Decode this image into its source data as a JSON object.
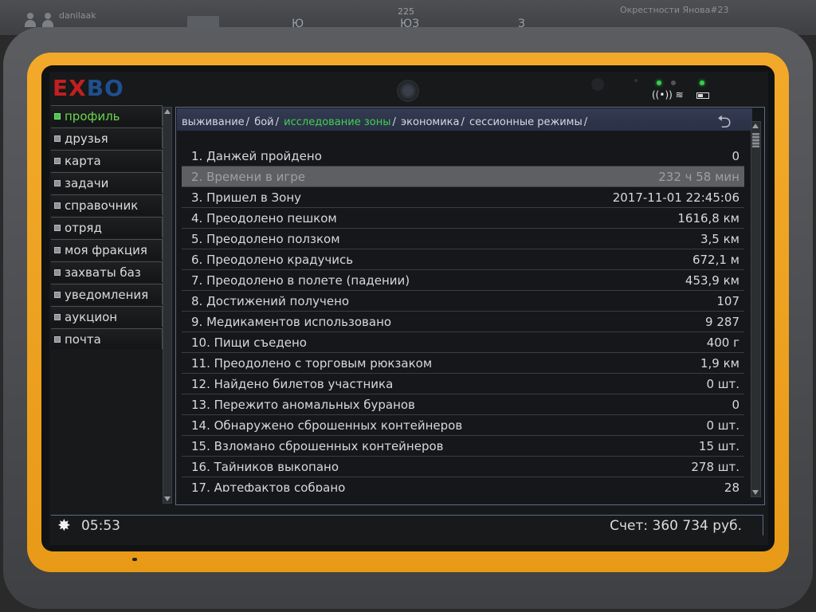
{
  "hud": {
    "player_name": "danilaak",
    "compass_left": "Ю",
    "compass_degree": "225",
    "compass_center": "ЮЗ",
    "compass_right": "З",
    "location": "Окрестности Янова#23"
  },
  "logo": {
    "left": "EX",
    "right": "BO"
  },
  "sidebar": {
    "items": [
      {
        "label": "профиль",
        "active": true
      },
      {
        "label": "друзья"
      },
      {
        "label": "карта"
      },
      {
        "label": "задачи"
      },
      {
        "label": "справочник"
      },
      {
        "label": "отряд"
      },
      {
        "label": "моя фракция"
      },
      {
        "label": "захваты баз"
      },
      {
        "label": "уведомления"
      },
      {
        "label": "аукцион"
      },
      {
        "label": "почта"
      }
    ]
  },
  "breadcrumb": {
    "items": [
      {
        "label": "выживание"
      },
      {
        "label": "бой"
      },
      {
        "label": "исследование зоны",
        "active": true
      },
      {
        "label": "экономика"
      },
      {
        "label": "сессионные режимы"
      }
    ]
  },
  "stats": [
    {
      "label": "1. Данжей пройдено",
      "value": "0"
    },
    {
      "label": "2. Времени в игре",
      "value": "232 ч 58 мин"
    },
    {
      "label": "3. Пришел в Зону",
      "value": "2017-11-01 22:45:06"
    },
    {
      "label": "4. Преодолено пешком",
      "value": "1616,8 км"
    },
    {
      "label": "5. Преодолено ползком",
      "value": "3,5 км"
    },
    {
      "label": "6. Преодолено крадучись",
      "value": "672,1 м"
    },
    {
      "label": "7. Преодолено в полете (падении)",
      "value": "453,9 км"
    },
    {
      "label": "8. Достижений получено",
      "value": "107"
    },
    {
      "label": "9. Медикаментов использовано",
      "value": "9 287"
    },
    {
      "label": "10. Пищи съедено",
      "value": "400 г"
    },
    {
      "label": "11. Преодолено с торговым рюкзаком",
      "value": "1,9 км"
    },
    {
      "label": "12. Найдено билетов участника",
      "value": "0 шт."
    },
    {
      "label": "13. Пережито аномальных буранов",
      "value": "0"
    },
    {
      "label": "14. Обнаружено сброшенных контейнеров",
      "value": "0 шт."
    },
    {
      "label": "15. Взломано сброшенных контейнеров",
      "value": "15 шт."
    },
    {
      "label": "16. Тайников выкопано",
      "value": "278 шт."
    },
    {
      "label": "17. Артефактов собрано",
      "value": "28"
    }
  ],
  "footer": {
    "time": "05:53",
    "balance": "Счет: 360 734 руб."
  },
  "icons": {
    "sun": "sun-icon",
    "back": "back-arrow-icon",
    "signal": "signal-icon",
    "battery": "battery-icon"
  },
  "colors": {
    "accent_green": "#3fd24f",
    "tablet_yellow": "#f2a92a",
    "logo_red": "#c41f1f",
    "logo_blue": "#1f4f8f"
  }
}
